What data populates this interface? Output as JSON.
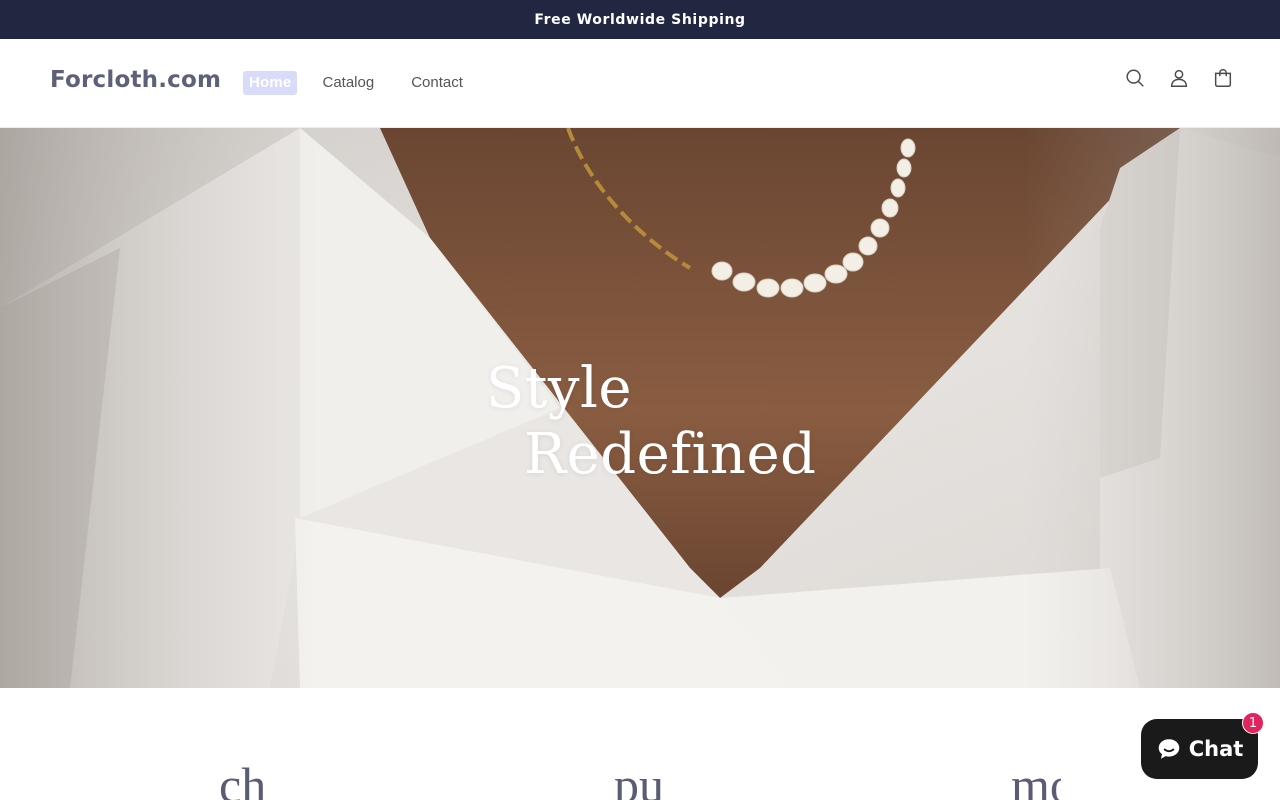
{
  "announcement": {
    "text": "Free Worldwide Shipping"
  },
  "header": {
    "logo": "Forcloth.com",
    "nav": [
      {
        "label": "Home",
        "active": true
      },
      {
        "label": "Catalog",
        "active": false
      },
      {
        "label": "Contact",
        "active": false
      }
    ],
    "icons": [
      "search-icon",
      "account-icon",
      "cart-icon"
    ]
  },
  "hero": {
    "line1": "Style",
    "line2": "Redefined"
  },
  "teasers": [
    "ch",
    "pu",
    "mo"
  ],
  "chat": {
    "label": "Chat",
    "badge": "1"
  },
  "colors": {
    "announcement_bg": "#212641",
    "logo": "#5d6078",
    "nav_active_bg": "#d9dbfb",
    "chat_bg": "#1a1a1a",
    "badge": "#e0245e"
  }
}
